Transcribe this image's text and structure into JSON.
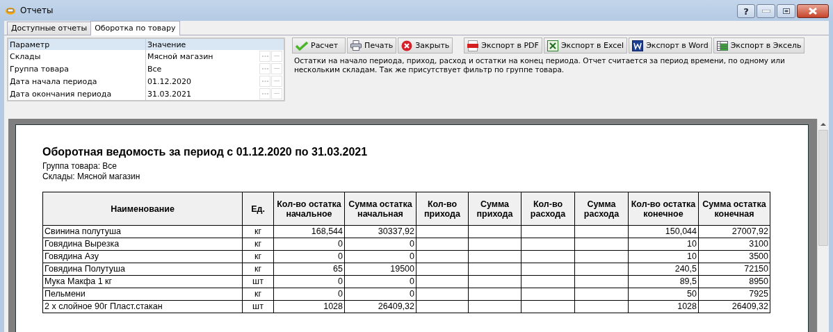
{
  "window": {
    "title": "Отчеты",
    "help": "?"
  },
  "tabs": [
    {
      "label": "Доступные отчеты",
      "selected": false
    },
    {
      "label": "Оборотка по товару",
      "selected": true
    }
  ],
  "params": {
    "columns": [
      "Параметр",
      "Значение"
    ],
    "rows": [
      {
        "name": "Склады",
        "value": "Мясной магазин"
      },
      {
        "name": "Группа товара",
        "value": "Все"
      },
      {
        "name": "Дата начала периода",
        "value": "01.12.2020"
      },
      {
        "name": "Дата окончания периода",
        "value": "31.03.2021"
      }
    ]
  },
  "toolbar": [
    {
      "label": "Расчет",
      "kind": "check"
    },
    {
      "label": "Печать",
      "kind": "print"
    },
    {
      "label": "Закрыть",
      "kind": "close"
    },
    {
      "label": "Экспорт в PDF",
      "kind": "pdf"
    },
    {
      "label": "Экспорт в Excel",
      "kind": "excel"
    },
    {
      "label": "Экспорт в Word",
      "kind": "word"
    },
    {
      "label": "Экспорт в Эксель",
      "kind": "sheet"
    }
  ],
  "description": "Остатки на начало периода, приход, расход и остатки на конец периода. Отчет считается за период времени, по одному или нескольким складам. Так же присутствует фильтр по группе товара.",
  "report": {
    "title": "Оборотная ведомость за период с 01.12.2020 по 31.03.2021",
    "subtitles": [
      "Группа товара: Все",
      "Склады: Мясной магазин"
    ],
    "columns": [
      "Наименование",
      "Ед.",
      "Кол-во остатка начальное",
      "Сумма остатка начальная",
      "Кол-во прихода",
      "Сумма прихода",
      "Кол-во расхода",
      "Сумма расхода",
      "Кол-во остатка конечное",
      "Сумма остатка конечная"
    ],
    "rows": [
      [
        "Свинина  полутуша",
        "кг",
        "168,544",
        "30337,92",
        "",
        "",
        "",
        "",
        "150,044",
        "27007,92"
      ],
      [
        "Говядина Вырезка",
        "кг",
        "0",
        "0",
        "",
        "",
        "",
        "",
        "10",
        "3100"
      ],
      [
        "Говядина Азу",
        "кг",
        "0",
        "0",
        "",
        "",
        "",
        "",
        "10",
        "3500"
      ],
      [
        "Говядина  Полутуша",
        "кг",
        "65",
        "19500",
        "",
        "",
        "",
        "",
        "240,5",
        "72150"
      ],
      [
        "Мука Макфа 1 кг",
        "шт",
        "0",
        "0",
        "",
        "",
        "",
        "",
        "89,5",
        "8950"
      ],
      [
        "Пельмени",
        "кг",
        "0",
        "0",
        "",
        "",
        "",
        "",
        "50",
        "7925"
      ],
      [
        "2 х слойное 90г Пласт.стакан",
        "шт",
        "1028",
        "26409,32",
        "",
        "",
        "",
        "",
        "1028",
        "26409,32"
      ]
    ]
  }
}
